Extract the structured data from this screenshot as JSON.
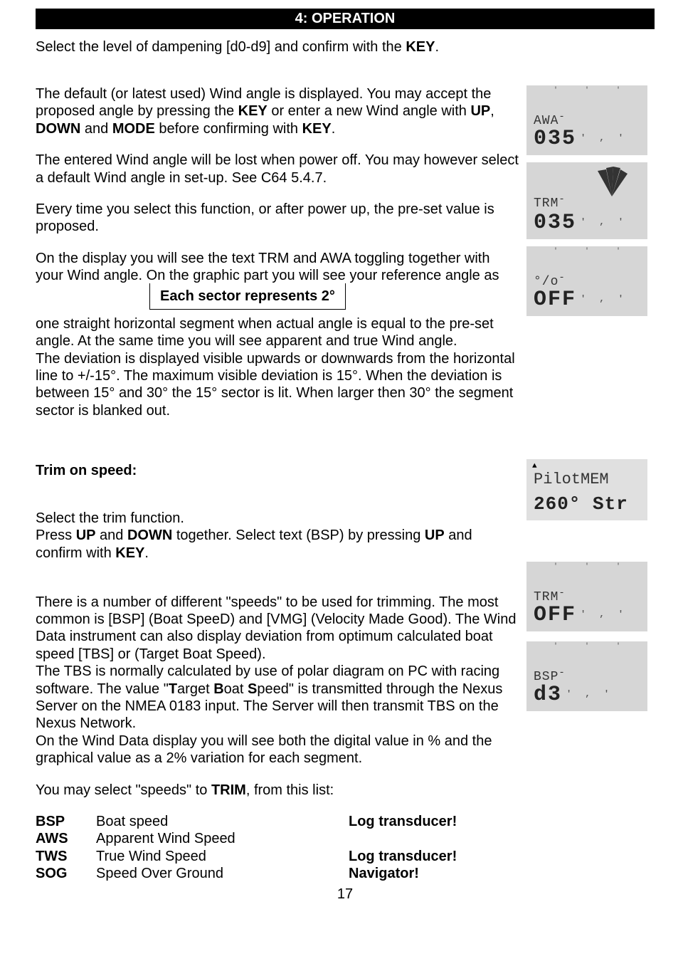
{
  "header": "4:  OPERATION",
  "para_intro_prefix": "Select the level of dampening [d0-d9] and confirm with the ",
  "key": "KEY",
  "p1_a": "The default (or latest used) Wind angle is displayed. You may accept the proposed angle by pressing the ",
  "p1_b": " or enter a new Wind angle with ",
  "up": "UP",
  "down": "DOWN",
  "and": " and ",
  "mode": "MODE",
  "p1_c": " before confirming with ",
  "p2": "The entered Wind angle will be lost when power off. You may however select a default Wind angle in set-up. See C64 5.4.7.",
  "p3": "Every time you select this function, or after power up, the pre-set value is proposed.",
  "p4": "On the display you will see the text TRM and AWA toggling together with your Wind angle. On the graphic part you will see your reference angle as",
  "boxed": "Each sector represents 2°",
  "p5": "one straight horizontal segment  when actual angle is equal to the pre-set angle. At the same time you will see apparent and true Wind angle.\nThe deviation is displayed visible upwards or downwards from the horizontal line to +/-15°. The maximum visible deviation is 15°. When the deviation is between 15° and 30° the 15° sector is lit. When larger then 30° the segment sector is blanked out.",
  "trim_heading": "Trim on speed:",
  "p6_a": "Select the trim function.\nPress ",
  "p6_b": " together. Select text (BSP) by pressing ",
  "p6_c": " and confirm  with ",
  "p7_a": "There is a number of different \"speeds\" to be used for trimming. The most common is [BSP] (Boat SpeeD) and [VMG] (Velocity Made Good). The Wind Data instrument can also display deviation from optimum calculated boat speed [TBS] or (Target Boat Speed).\nThe TBS is normally calculated by use of polar diagram on PC with racing software. The value \"",
  "p7_b_t": "T",
  "p7_b_arget": "arget ",
  "p7_b_b": "B",
  "p7_b_oat": "oat ",
  "p7_b_s": "S",
  "p7_b_peed": "peed\" is transmitted through the Nexus Server on the NMEA 0183 input. The Server will then transmit TBS on the Nexus Network.\nOn the Wind Data display you will see both the digital value in % and the graphical value as a 2% variation for each segment.",
  "p8_a": "You may select \"speeds\" to ",
  "trim": "TRIM",
  "p8_b": ", from this list:",
  "speeds": [
    {
      "abbr": "BSP",
      "desc": "Boat speed",
      "note": "Log transducer!"
    },
    {
      "abbr": "AWS",
      "desc": "Apparent Wind Speed",
      "note": ""
    },
    {
      "abbr": "TWS",
      "desc": "True Wind Speed",
      "note": "Log transducer!"
    },
    {
      "abbr": "SOG",
      "desc": "Speed Over Ground",
      "note": "Navigator!"
    }
  ],
  "page_num": "17",
  "lcd": {
    "awa": {
      "small": "AWA",
      "big": "035"
    },
    "trm035": {
      "small": "TRM",
      "big": "035"
    },
    "off1": {
      "small": "°/o",
      "big": "OFF"
    },
    "pilot": {
      "small": "PilotMEM",
      "big": "260° Str"
    },
    "trmoff": {
      "small": "TRM",
      "big": "OFF"
    },
    "bsp": {
      "small": "BSP",
      "big": " d3"
    }
  }
}
